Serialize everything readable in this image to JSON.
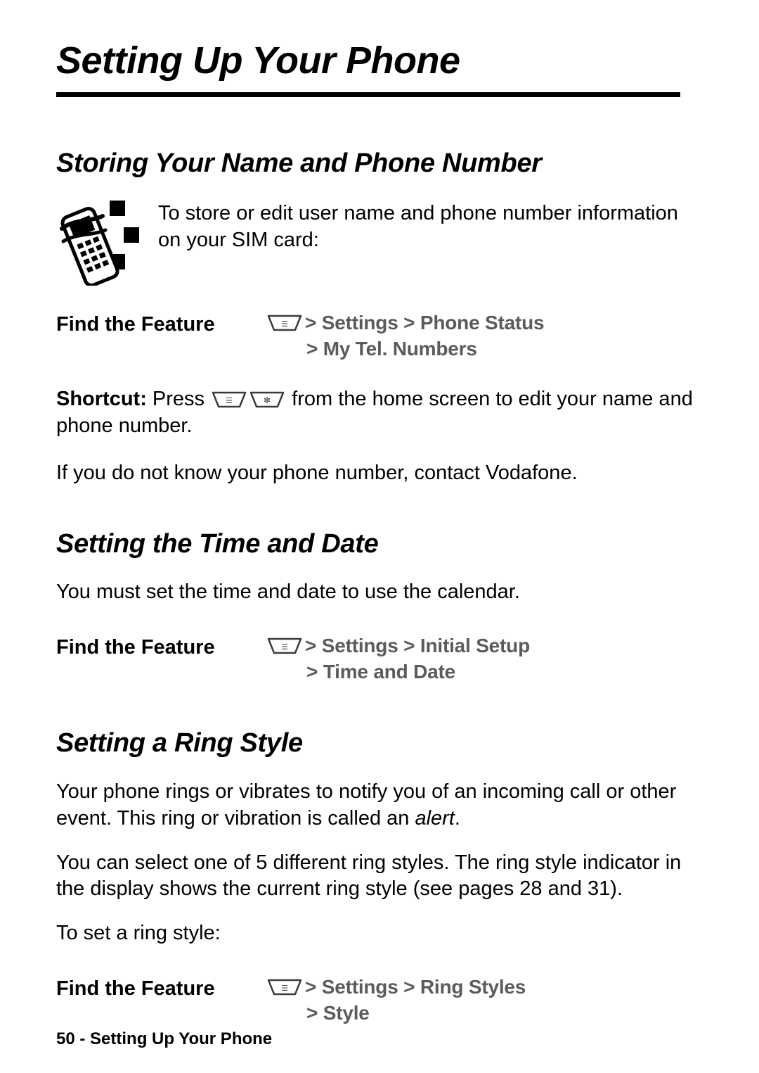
{
  "document": {
    "title": "Setting Up Your Phone",
    "footer": {
      "page_number": "50",
      "separator": " - ",
      "text": "Setting Up Your Phone"
    }
  },
  "sections": [
    {
      "heading": "Storing Your Name and Phone Number",
      "icon": "phone-with-squares-icon",
      "intro": "To store or edit user name and phone number information on your SIM card:",
      "find_feature": {
        "label": "Find the Feature",
        "key_icon": "menu-key-icon",
        "line1": "> Settings > Phone Status",
        "line2": "> My Tel. Numbers"
      },
      "shortcut": {
        "label": "Shortcut:",
        "before_keys": " Press ",
        "key1": "menu-key-icon",
        "key2": "star-key-icon",
        "after_keys": " from the home screen to edit your name and phone number."
      },
      "note": "If you do not know your phone number, contact Vodafone."
    },
    {
      "heading": "Setting the Time and Date",
      "intro": "You must set the time and date to use the calendar.",
      "find_feature": {
        "label": "Find the Feature",
        "key_icon": "menu-key-icon",
        "line1": "> Settings > Initial Setup",
        "line2": "> Time and Date"
      }
    },
    {
      "heading": "Setting a Ring Style",
      "para1_a": "Your phone rings or vibrates to notify you of an incoming call or other event. This ring or vibration is called an ",
      "para1_em": "alert",
      "para1_b": ".",
      "para2": "You can select one of 5 different ring styles. The ring style indicator in the display shows the current ring style (see pages 28 and 31).",
      "para3": "To set a ring style:",
      "find_feature": {
        "label": "Find the Feature",
        "key_icon": "menu-key-icon",
        "line1": "> Settings > Ring Styles",
        "line2": "> Style"
      }
    }
  ]
}
